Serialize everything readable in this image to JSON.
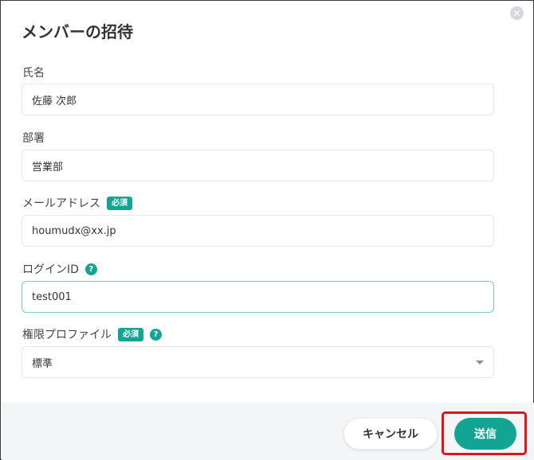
{
  "dialog": {
    "title": "メンバーの招待",
    "close_icon": "close-icon"
  },
  "fields": {
    "name": {
      "label": "氏名",
      "value": "佐藤 次郎"
    },
    "department": {
      "label": "部署",
      "value": "営業部"
    },
    "email": {
      "label": "メールアドレス",
      "required_badge": "必須",
      "value": "houmudx@xx.jp"
    },
    "login_id": {
      "label": "ログインID",
      "help": "?",
      "value": "test001"
    },
    "permission_profile": {
      "label": "権限プロファイル",
      "required_badge": "必須",
      "help": "?",
      "selected": "標準"
    }
  },
  "footer": {
    "cancel_label": "キャンセル",
    "send_label": "送信"
  },
  "colors": {
    "accent": "#12a594",
    "highlight": "#e0141e"
  }
}
